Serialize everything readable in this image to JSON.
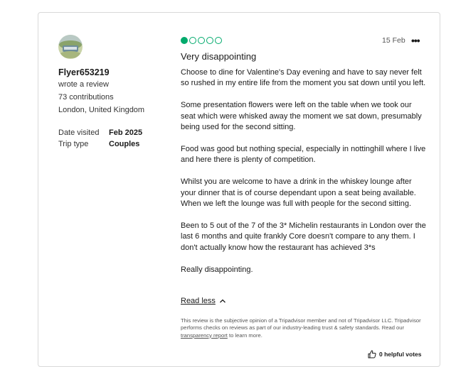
{
  "reviewer": {
    "name": "Flyer653219",
    "action": "wrote a review",
    "contributions": "73 contributions",
    "location": "London, United Kingdom"
  },
  "details": [
    {
      "label": "Date visited",
      "value": "Feb 2025"
    },
    {
      "label": "Trip type",
      "value": "Couples"
    }
  ],
  "review": {
    "rating": 1,
    "rating_max": 5,
    "date": "15 Feb",
    "title": "Very disappointing",
    "paragraphs": [
      "Choose to dine for Valentine's Day evening and  have to say never felt so rushed in my entire life from the moment you sat down until you left.",
      "Some presentation flowers were left on the table when we took our seat which were whisked away the moment we sat down, presumably being used for the second sitting.",
      "Food was good but nothing special, especially in nottinghill where I live and here there is plenty of competition.",
      "Whilst you are welcome to have a drink in the whiskey lounge after your dinner that is of course dependant upon a seat being available. When we left the lounge was full with people for the second sitting.",
      "Been to 5 out of the 7 of the 3* Michelin restaurants in London over the last 6 months and quite frankly Core doesn't compare to any them. I don't actually know how the restaurant has achieved 3*s",
      "Really disappointing."
    ],
    "read_less": "Read less"
  },
  "disclaimer": {
    "before_link": "This review is the subjective opinion of a Tripadvisor member and not of Tripadvisor LLC. Tripadvisor performs checks on reviews as part of our industry-leading trust & safety standards. Read our ",
    "link": "transparency report",
    "after_link": " to learn more."
  },
  "votes": "0 helpful votes",
  "colors": {
    "rating_green": "#00aa6c"
  },
  "icons": [
    "more-options-icon",
    "chevron-up-icon",
    "thumbs-up-icon"
  ]
}
